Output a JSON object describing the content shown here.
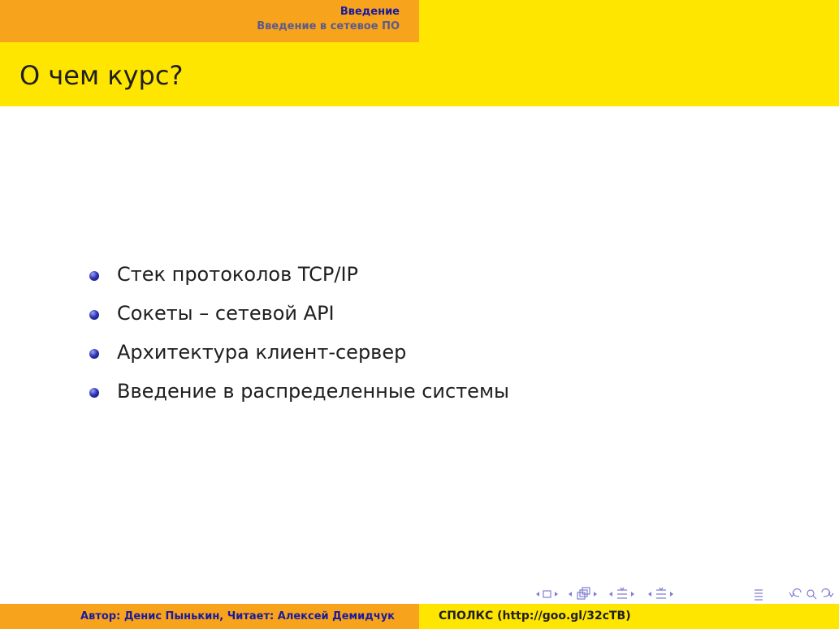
{
  "header": {
    "section": "Введение",
    "subsection": "Введение в сетевое ПО"
  },
  "frame": {
    "title": "О чем курс?"
  },
  "bullets": [
    "Стек протоколов TCP/IP",
    "Сокеты – сетевой API",
    "Архитектура клиент-сервер",
    "Введение в распределенные системы"
  ],
  "navigation": {
    "icons": [
      "frame-prev-icon",
      "frame-icon",
      "frame-next-icon",
      "subsection-prev-icon",
      "subsection-icon",
      "subsection-next-icon",
      "section-prev-icon",
      "section-icon",
      "section-next-icon",
      "document-prev-icon",
      "document-icon",
      "document-next-icon",
      "align-icon",
      "back-icon",
      "search-icon",
      "forward-icon"
    ]
  },
  "footer": {
    "author": "Автор: Денис Пынькин, Читает: Алексей Демидчук",
    "course": "СПОЛКС (http://goo.gl/32cTB)"
  },
  "colors": {
    "orange": "#f7a31c",
    "yellow": "#ffe600",
    "blue_text": "#1b1b9c",
    "gray_blue_text": "#5a5a8c",
    "nav_icons": "#7e7fd1"
  }
}
